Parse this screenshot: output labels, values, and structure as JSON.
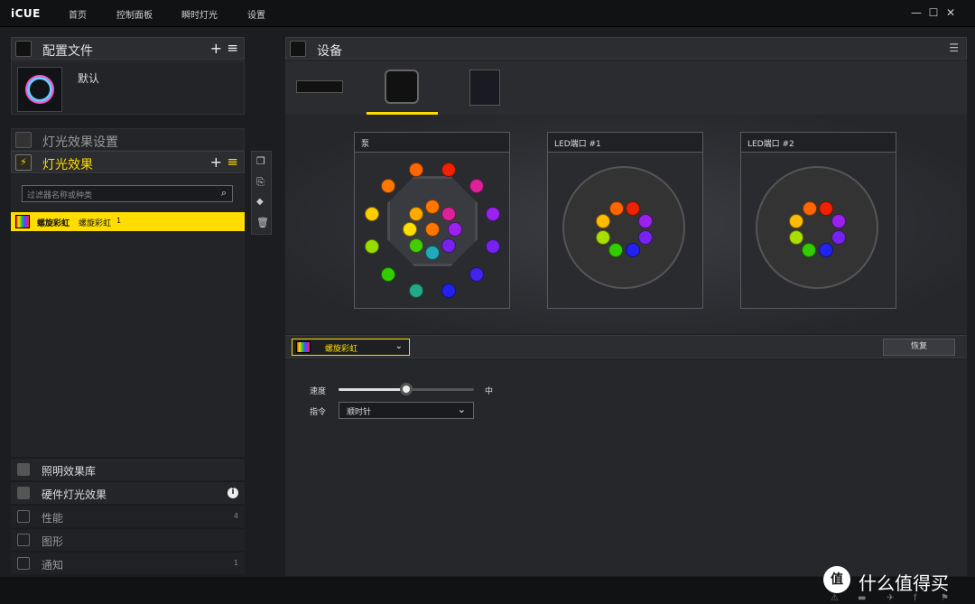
{
  "app": {
    "logo": "iCUE"
  },
  "nav": {
    "home": "首页",
    "dashboard": "控制面板",
    "instant": "瞬时灯光",
    "settings": "设置"
  },
  "profiles": {
    "title": "配置文件",
    "add": "+",
    "menu": "≡",
    "default_name": "默认"
  },
  "lighting_settings": {
    "title": "灯光效果设置"
  },
  "lighting_effects": {
    "title": "灯光效果",
    "add": "+",
    "menu": "≡",
    "filter_placeholder": "过滤器名称或种类",
    "item_name": "螺旋彩虹",
    "item_desc": "螺旋彩虹",
    "item_count": "1"
  },
  "bottom": {
    "library": "照明效果库",
    "hardware": "硬件灯光效果",
    "performance": "性能",
    "performance_count": "4",
    "graphics": "图形",
    "notify": "通知",
    "notify_count": "1"
  },
  "devices": {
    "title": "设备"
  },
  "cards": [
    {
      "title": "泵"
    },
    {
      "title": "LED端口 #1"
    },
    {
      "title": "LED端口 #2"
    }
  ],
  "effect": {
    "selected": "螺旋彩虹",
    "restore": "恢复",
    "speed_label": "速度",
    "speed_value": "中",
    "speed_fraction": 0.5,
    "direction_label": "指令",
    "direction_value": "顺时针"
  },
  "watermark": {
    "text": "什么值得买",
    "logo": "值"
  },
  "colors": {
    "accent": "#ffdd00",
    "bg": "#1c1d20"
  }
}
